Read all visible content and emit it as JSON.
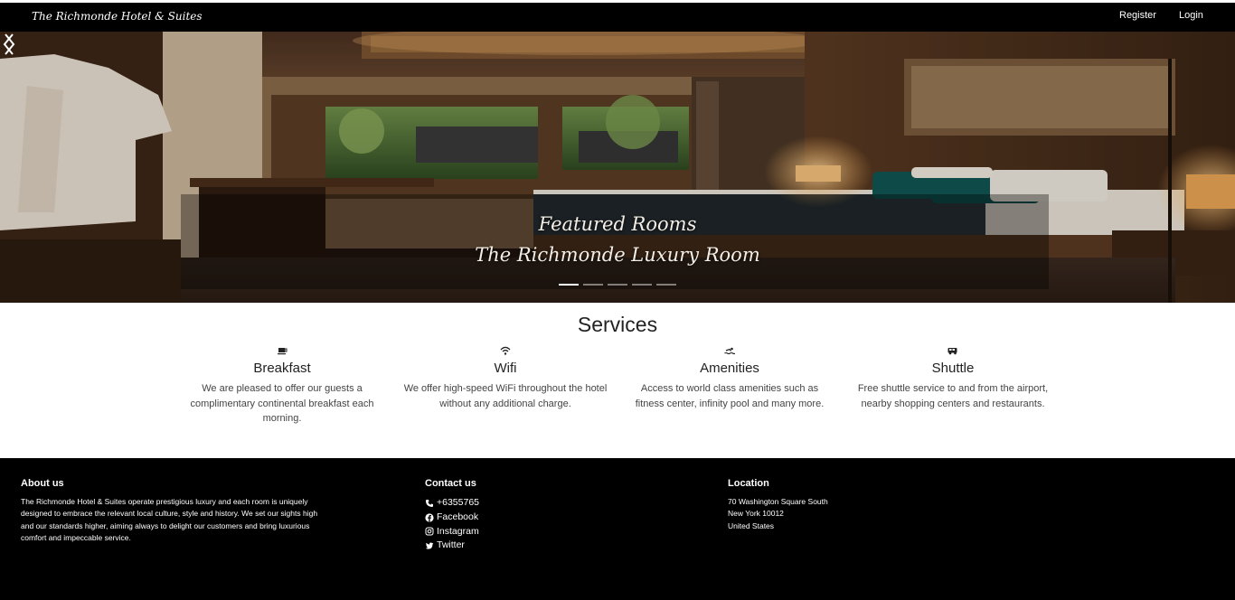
{
  "navbar": {
    "brand": "The Richmonde Hotel & Suites",
    "register_label": "Register",
    "login_label": "Login"
  },
  "hero": {
    "caption_title": "Featured Rooms",
    "caption_subtitle": "The Richmonde Luxury Room",
    "slide_count": 5,
    "active_slide": 1
  },
  "services": {
    "title": "Services",
    "items": [
      {
        "icon": "coffee-icon",
        "title": "Breakfast",
        "description": "We are pleased to offer our guests a complimentary continental breakfast each morning."
      },
      {
        "icon": "wifi-icon",
        "title": "Wifi",
        "description": "We offer high-speed WiFi throughout the hotel without any additional charge."
      },
      {
        "icon": "swimmer-icon",
        "title": "Amenities",
        "description": "Access to world class amenities such as fitness center, infinity pool and many more."
      },
      {
        "icon": "shuttle-van-icon",
        "title": "Shuttle",
        "description": "Free shuttle service to and from the airport, nearby shopping centers and restaurants."
      }
    ]
  },
  "footer": {
    "about": {
      "heading": "About us",
      "text": "The Richmonde Hotel & Suites operate prestigious luxury and each room is uniquely designed to embrace the relevant local culture, style and history. We set our sights high and our standards higher, aiming always to delight our customers and bring luxurious comfort and impeccable service."
    },
    "contact": {
      "heading": "Contact us",
      "phone": "+6355765",
      "facebook": "Facebook",
      "instagram": "Instagram",
      "twitter": "Twitter"
    },
    "location": {
      "heading": "Location",
      "line1": "70 Washington Square South",
      "line2": "New York 10012",
      "line3": "United States"
    }
  },
  "colors": {
    "navbar_bg": "#000000",
    "footer_bg": "#000000",
    "text_dark": "#222222",
    "text_light": "#ffffff"
  }
}
